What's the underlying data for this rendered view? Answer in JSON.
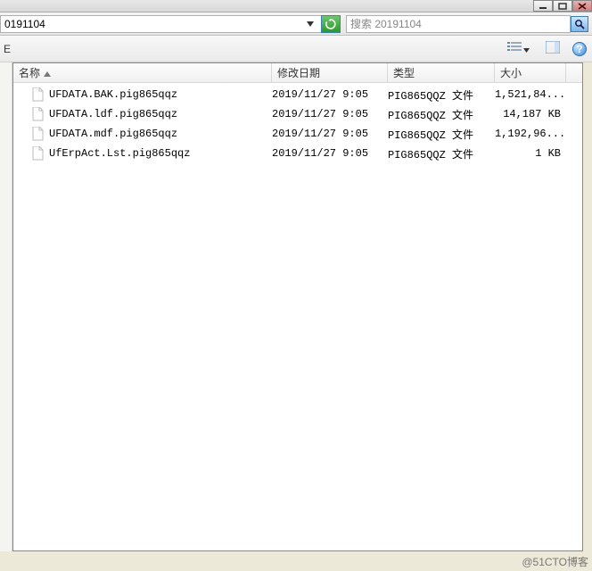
{
  "titlebar": {
    "min_tip": "Minimize",
    "max_tip": "Maximize",
    "close_tip": "Close"
  },
  "nav": {
    "path_text": "0191104",
    "search_placeholder": "搜索 20191104"
  },
  "toolbar": {
    "left_hint": "E"
  },
  "columns": {
    "name": "名称",
    "date": "修改日期",
    "type": "类型",
    "size": "大小"
  },
  "files": [
    {
      "name": "UFDATA.BAK.pig865qqz",
      "date": "2019/11/27 9:05",
      "type": "PIG865QQZ 文件",
      "size": "1,521,84..."
    },
    {
      "name": "UFDATA.ldf.pig865qqz",
      "date": "2019/11/27 9:05",
      "type": "PIG865QQZ 文件",
      "size": "14,187 KB"
    },
    {
      "name": "UFDATA.mdf.pig865qqz",
      "date": "2019/11/27 9:05",
      "type": "PIG865QQZ 文件",
      "size": "1,192,96..."
    },
    {
      "name": "UfErpAct.Lst.pig865qqz",
      "date": "2019/11/27 9:05",
      "type": "PIG865QQZ 文件",
      "size": "1 KB"
    }
  ],
  "watermark": "@51CTO博客"
}
